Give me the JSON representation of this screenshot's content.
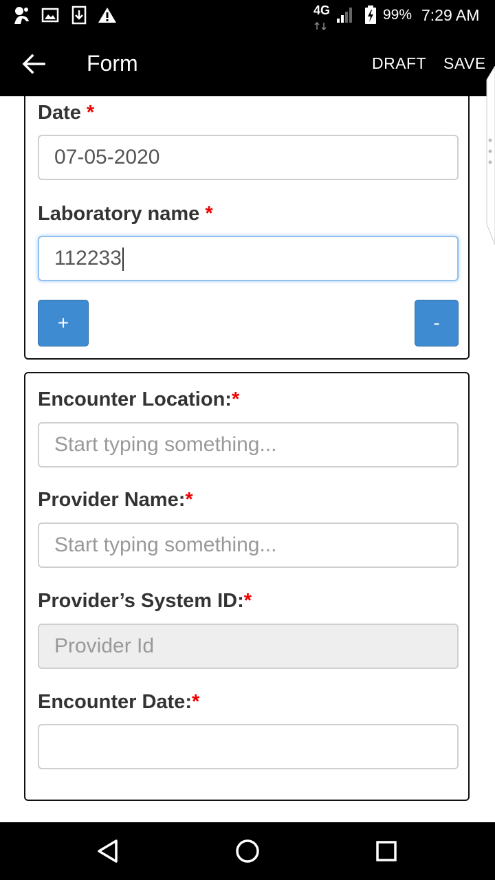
{
  "status_bar": {
    "network": "4G",
    "battery": "99%",
    "time": "7:29 AM",
    "left_icons": [
      "app-notification-icon",
      "image-icon",
      "download-icon",
      "warning-icon"
    ],
    "right_icons": [
      "data-arrows-icon",
      "signal-icon",
      "battery-charging-icon"
    ]
  },
  "app_bar": {
    "title": "Form",
    "back_icon": "arrow-left-icon",
    "draft_label": "DRAFT",
    "save_label": "SAVE"
  },
  "lab_card": {
    "date": {
      "label": "Date",
      "required": "*",
      "value": "07-05-2020"
    },
    "laboratory": {
      "label": "Laboratory name",
      "required": "*",
      "value": "112233"
    },
    "add_label": "+",
    "remove_label": "-"
  },
  "encounter_card": {
    "location": {
      "label": "Encounter Location:",
      "required": "*",
      "placeholder": "Start typing something..."
    },
    "provider_name": {
      "label": "Provider Name:",
      "required": "*",
      "placeholder": "Start typing something..."
    },
    "provider_id": {
      "label": "Provider’s System ID:",
      "required": "*",
      "placeholder": "Provider Id"
    },
    "encounter_date": {
      "label": "Encounter Date:",
      "required": "*",
      "value": ""
    }
  },
  "nav_bar": {
    "icons": [
      "back-triangle-icon",
      "home-circle-icon",
      "recents-square-icon"
    ]
  },
  "colors": {
    "accent": "#3f8bd1",
    "required": "#e00000",
    "app_bar": "#000000",
    "focus_border": "#8fc1ee"
  }
}
